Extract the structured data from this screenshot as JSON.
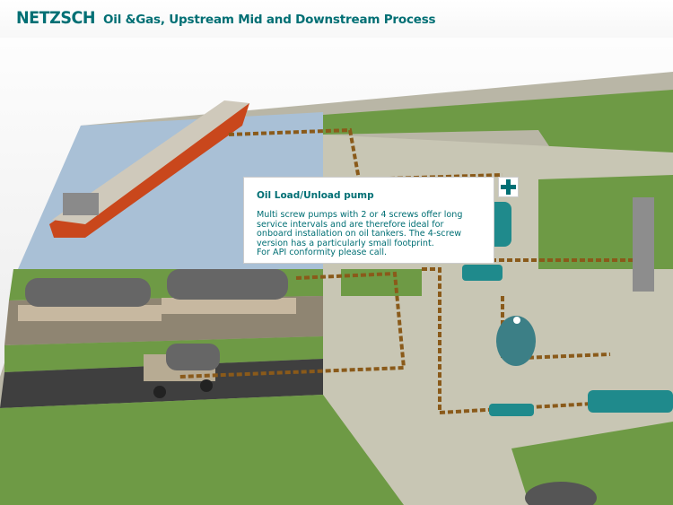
{
  "header": {
    "logo": "NETZSCH",
    "title": "Oil &Gas, Upstream Mid and Downstream Process"
  },
  "popup": {
    "title": "Oil Load/Unload pump",
    "lines": [
      "Multi screw pumps with 2 or 4 screws offer long",
      "service intervals and are therefore ideal for",
      "onboard installation on oil tankers. The 4-screw",
      "version has a particularly small footprint.",
      "For API conformity please call."
    ]
  },
  "colors": {
    "brand": "#006f74",
    "grass": "#6e9a45",
    "concrete": "#c9c7b6",
    "water": "#9bb6cf",
    "road": "#3f3f3f",
    "pump": "#1f8a8c"
  }
}
